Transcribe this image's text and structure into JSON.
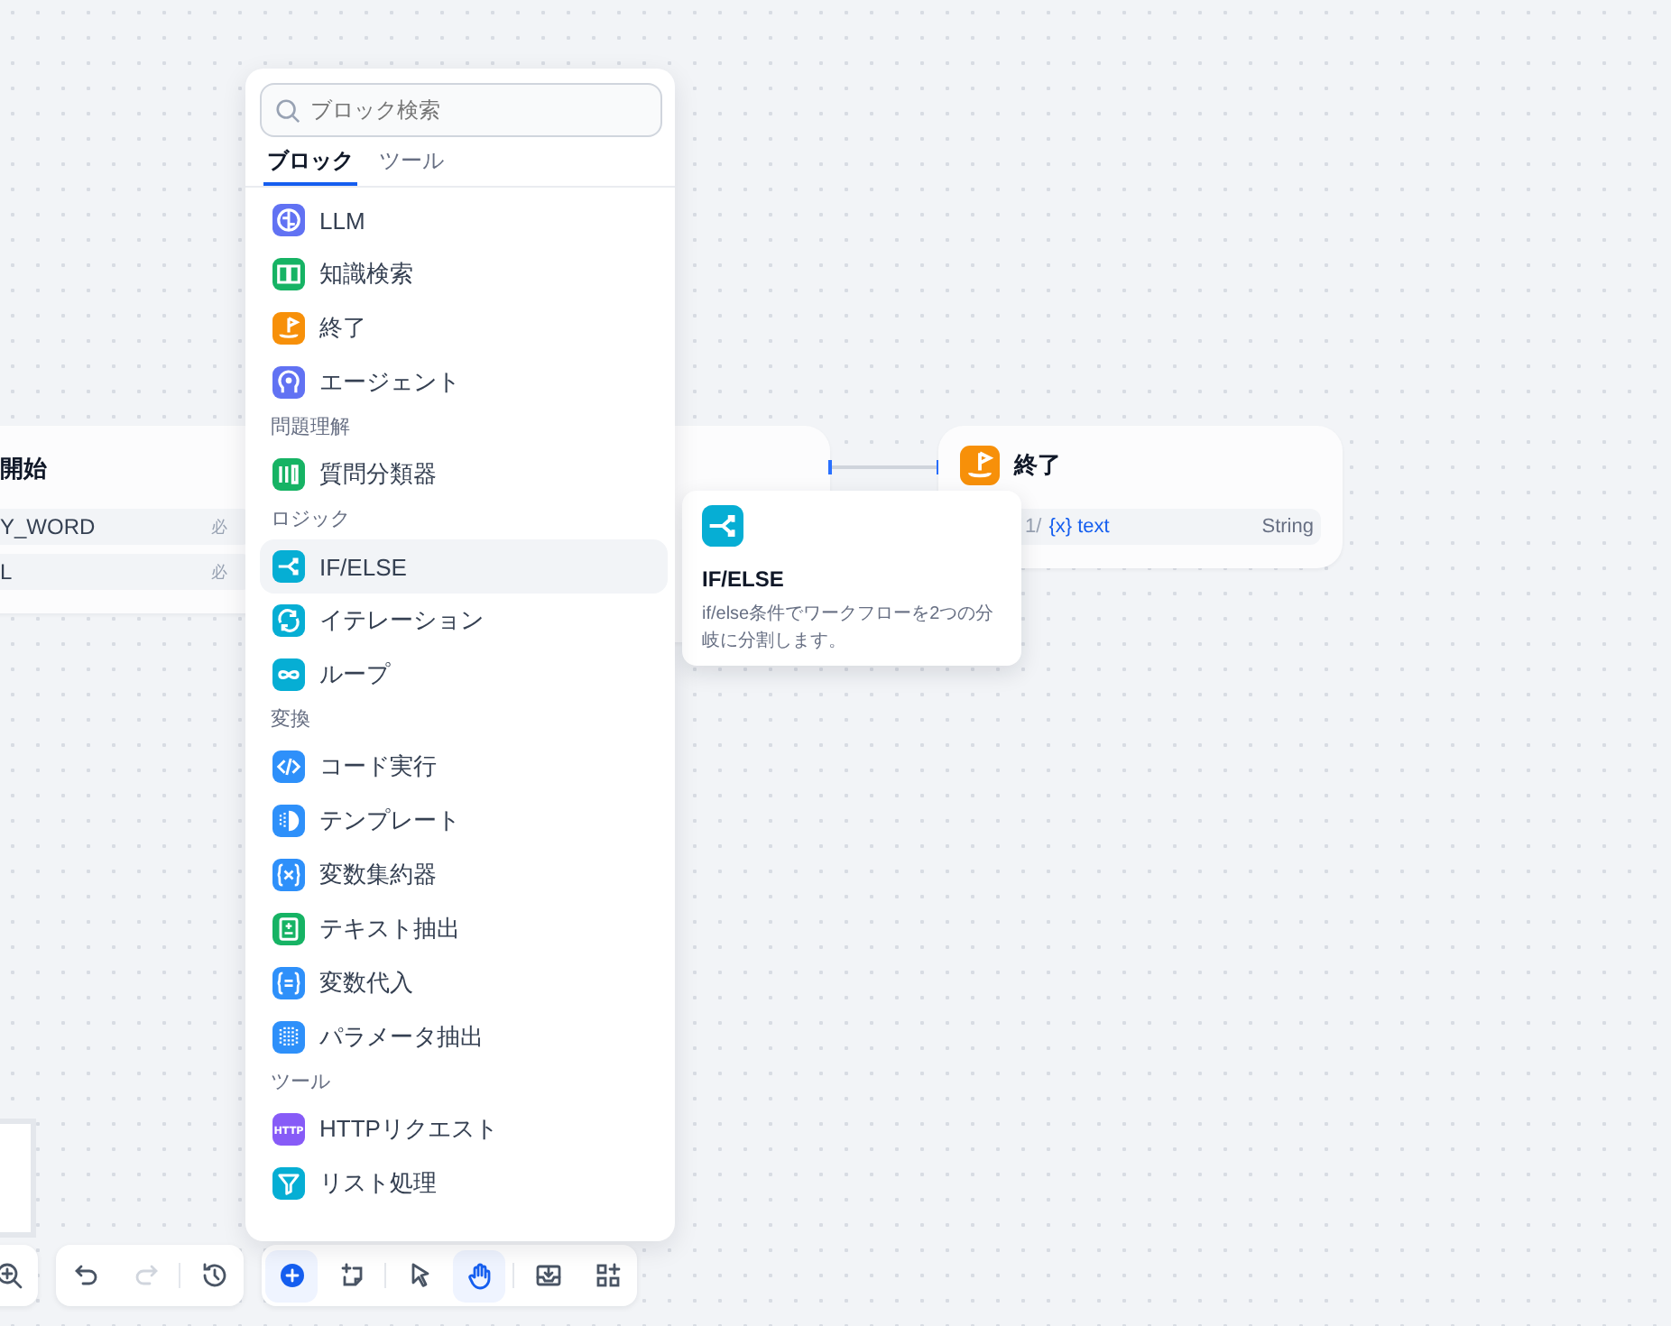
{
  "start_node": {
    "title": "開始",
    "variables": [
      {
        "name": "Y_WORD",
        "badge": "必"
      },
      {
        "name": "L",
        "badge": "必"
      }
    ]
  },
  "end_node": {
    "title": "終了",
    "output": {
      "prefix": "1/",
      "variable": "{x} text",
      "type": "String"
    }
  },
  "tooltip": {
    "color": "#06aed4",
    "title": "IF/ELSE",
    "description": "if/else条件でワークフローを2つの分岐に分割します。"
  },
  "block_menu": {
    "search": {
      "placeholder": "ブロック検索"
    },
    "tabs": [
      {
        "label": "ブロック",
        "selected": true
      },
      {
        "label": "ツール",
        "selected": false
      }
    ],
    "groups": [
      {
        "items": [
          {
            "label": "LLM",
            "color": "#6172f3",
            "selected": false
          },
          {
            "label": "知識検索",
            "color": "#16b364",
            "selected": false
          },
          {
            "label": "終了",
            "color": "#f79009",
            "selected": false
          },
          {
            "label": "エージェント",
            "color": "#6172f3",
            "selected": false
          }
        ]
      },
      {
        "title": "問題理解",
        "items": [
          {
            "label": "質問分類器",
            "color": "#16b364",
            "selected": false
          }
        ]
      },
      {
        "title": "ロジック",
        "items": [
          {
            "label": "IF/ELSE",
            "color": "#06aed4",
            "selected": true
          },
          {
            "label": "イテレーション",
            "color": "#06aed4",
            "selected": false
          },
          {
            "label": "ループ",
            "color": "#06aed4",
            "selected": false
          }
        ]
      },
      {
        "title": "変換",
        "items": [
          {
            "label": "コード実行",
            "color": "#2e90fa",
            "selected": false
          },
          {
            "label": "テンプレート",
            "color": "#2e90fa",
            "selected": false
          },
          {
            "label": "変数集約器",
            "color": "#2e90fa",
            "selected": false
          },
          {
            "label": "テキスト抽出",
            "color": "#16b364",
            "selected": false
          },
          {
            "label": "変数代入",
            "color": "#2e90fa",
            "selected": false
          },
          {
            "label": "パラメータ抽出",
            "color": "#2e90fa",
            "selected": false
          }
        ]
      },
      {
        "title": "ツール",
        "items": [
          {
            "label": "HTTPリクエスト",
            "icon_text": "HTTP",
            "color": "#875bf7",
            "selected": false
          },
          {
            "label": "リスト処理",
            "color": "#06aed4",
            "selected": false
          }
        ]
      }
    ]
  },
  "toolbars": [
    {
      "sections": [
        [
          {
            "selected": false,
            "disabled": false
          }
        ]
      ]
    },
    {
      "sections": [
        [
          {
            "selected": false,
            "disabled": false
          },
          {
            "selected": false,
            "disabled": true
          }
        ],
        [
          {
            "selected": false,
            "disabled": false
          }
        ]
      ]
    },
    {
      "sections": [
        [
          {
            "selected": true,
            "disabled": false
          },
          {
            "selected": false,
            "disabled": false
          }
        ],
        [
          {
            "selected": false,
            "disabled": false
          },
          {
            "selected": true,
            "disabled": false
          }
        ],
        [
          {
            "selected": false,
            "disabled": false
          },
          {
            "selected": false,
            "disabled": false
          }
        ]
      ]
    }
  ]
}
